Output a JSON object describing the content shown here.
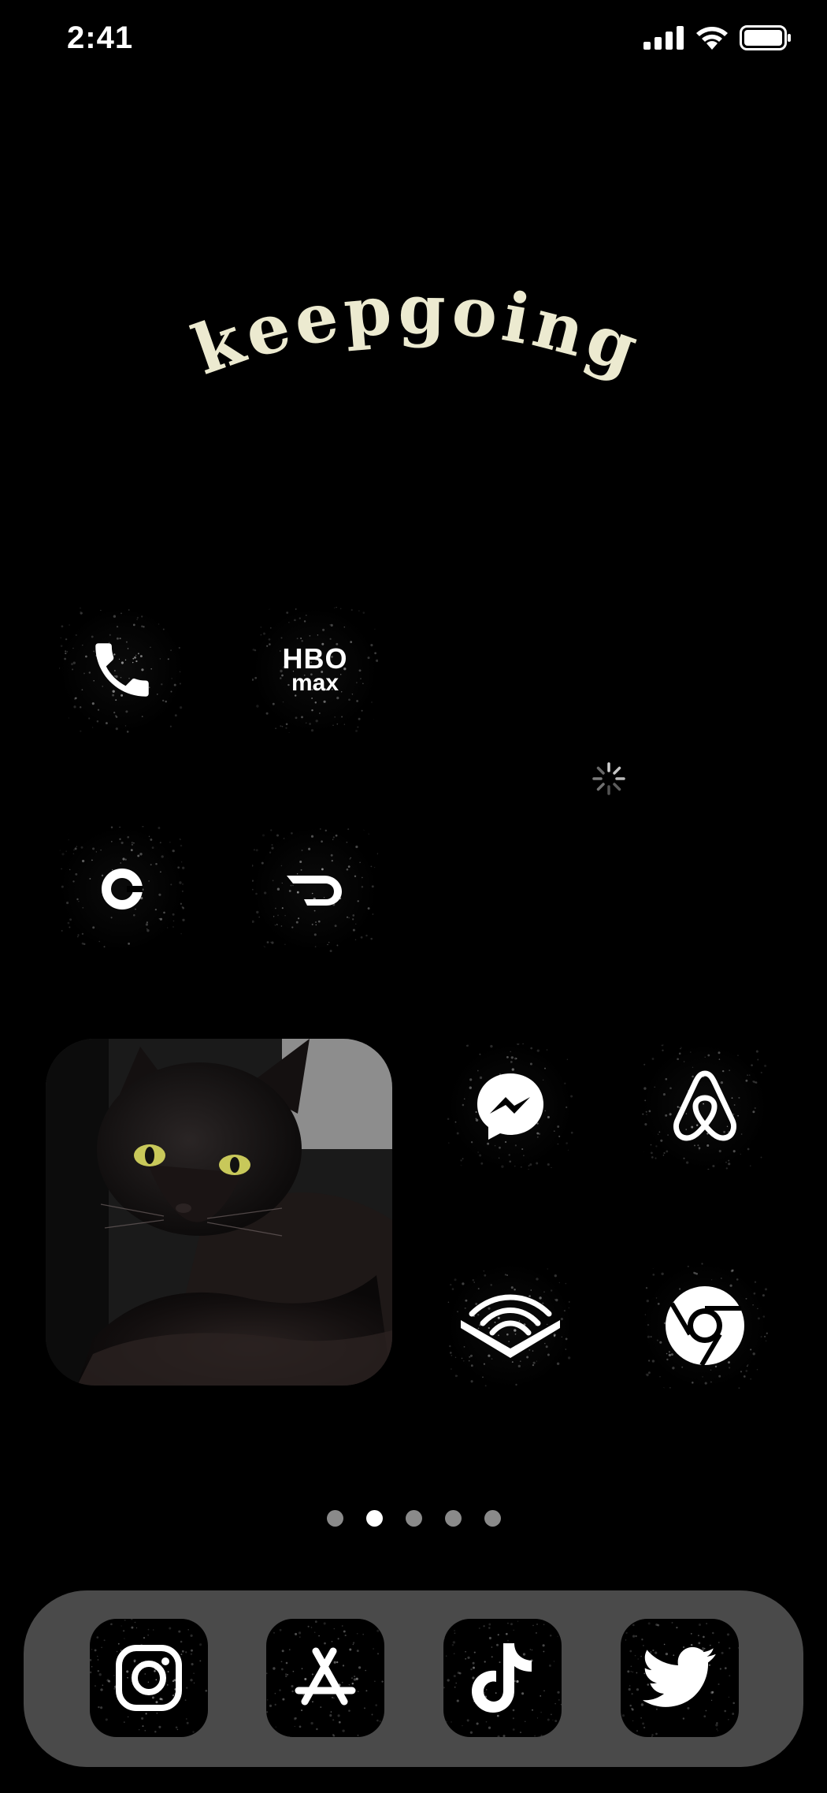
{
  "status_bar": {
    "time": "2:41",
    "icons": [
      "cellular-signal-icon",
      "wifi-icon",
      "battery-icon"
    ]
  },
  "widget": {
    "text": "keepgoing",
    "text_color": "#ecead0"
  },
  "home_apps": [
    {
      "name": "phone",
      "icon": "phone-icon"
    },
    {
      "name": "hbo-max",
      "icon": "hbo-max-icon",
      "label_top": "HBO",
      "label_bottom": "max"
    },
    {
      "name": "uber",
      "icon": "uber-icon"
    },
    {
      "name": "doordash",
      "icon": "doordash-icon"
    },
    {
      "name": "messenger",
      "icon": "messenger-icon"
    },
    {
      "name": "airbnb",
      "icon": "airbnb-icon"
    },
    {
      "name": "audible",
      "icon": "audible-icon"
    },
    {
      "name": "chrome",
      "icon": "chrome-icon"
    }
  ],
  "photo_widget": {
    "subject": "black-cat-photo"
  },
  "page_indicator": {
    "count": 5,
    "active_index": 1
  },
  "dock": [
    {
      "name": "instagram",
      "icon": "instagram-icon"
    },
    {
      "name": "app-store",
      "icon": "app-store-icon"
    },
    {
      "name": "tiktok",
      "icon": "tiktok-icon"
    },
    {
      "name": "twitter",
      "icon": "twitter-icon"
    }
  ],
  "colors": {
    "background": "#000000",
    "dock": "#4a4a4a",
    "icon_glyph": "#ffffff",
    "dot_inactive": "#8a8a8a"
  }
}
